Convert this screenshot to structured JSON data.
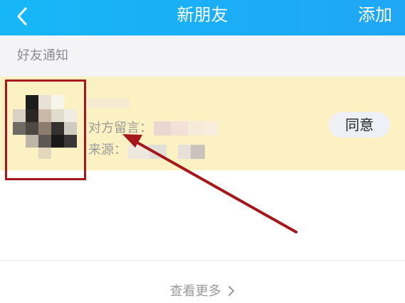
{
  "header": {
    "title": "新朋友",
    "add_label": "添加",
    "back_icon": "chevron-left-icon"
  },
  "section": {
    "title": "好友通知"
  },
  "notification": {
    "message_label": "对方留言：",
    "source_label": "来源：",
    "agree_label": "同意"
  },
  "footer": {
    "see_more_label": "查看更多",
    "see_more_icon": "chevron-right-icon"
  },
  "colors": {
    "header_bg": "#16b7f7",
    "row_bg": "#fcf1c2",
    "annotation_red": "#a4171c"
  }
}
